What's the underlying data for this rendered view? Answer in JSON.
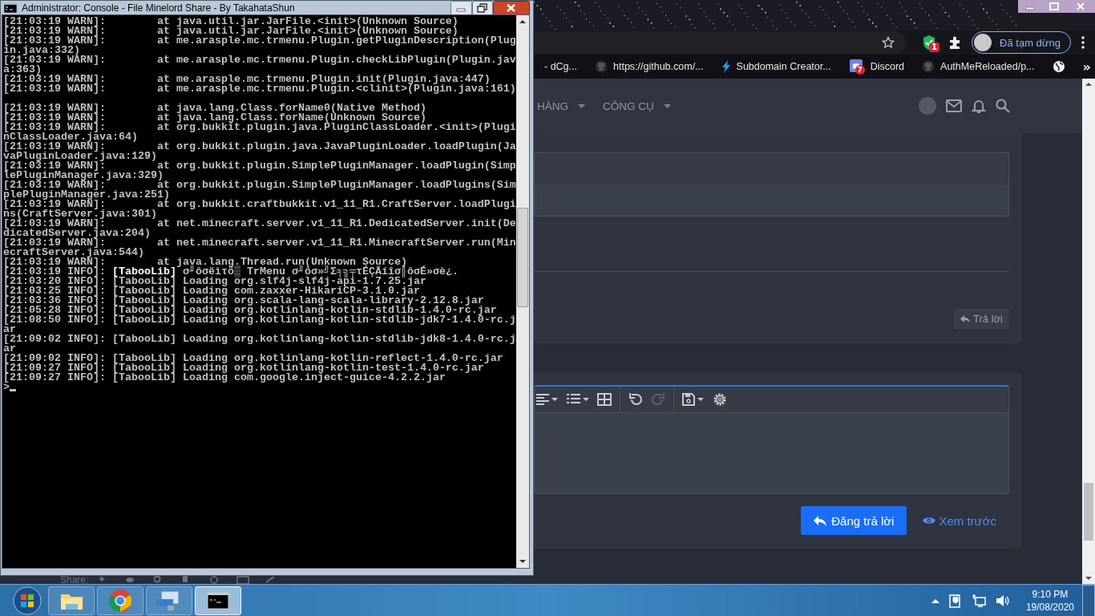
{
  "browser": {
    "extension_badge": "1",
    "profile_label": "Đã tạm dừng",
    "bookmarks": [
      {
        "kind": "plain",
        "label": "- dCg..."
      },
      {
        "kind": "github",
        "label": "https://github.com/..."
      },
      {
        "kind": "bolt",
        "label": "Subdomain Creator..."
      },
      {
        "kind": "discord",
        "label": "Discord",
        "badge": "7"
      },
      {
        "kind": "github",
        "label": "AuthMeReloaded/p..."
      }
    ],
    "bookmarks_overflow": "»"
  },
  "forum": {
    "nav": [
      {
        "label": "HÀNG"
      },
      {
        "label": "CÔNG CỤ"
      }
    ],
    "reply_button": "Trả lời",
    "editor_tools": [
      {
        "kind": "align",
        "disabled": false
      },
      {
        "kind": "list",
        "disabled": false
      },
      {
        "kind": "table",
        "disabled": false
      },
      {
        "kind": "undo",
        "disabled": false
      },
      {
        "kind": "redo",
        "disabled": true
      },
      {
        "kind": "save",
        "disabled": false
      },
      {
        "kind": "settings",
        "disabled": false
      }
    ],
    "post_button": "Đăng trả lời",
    "preview_link": "Xem trước",
    "share_label": "Share:"
  },
  "console": {
    "title": "Administrator:  Console - File Minelord Share - By TakahataShun",
    "lines": [
      "[21:03:19 WARN]:        at java.util.jar.JarFile.<init>(Unknown Source)",
      "[21:03:19 WARN]:        at java.util.jar.JarFile.<init>(Unknown Source)",
      "[21:03:19 WARN]:        at me.arasple.mc.trmenu.Plugin.getPluginDescription(Plugin.java:332)",
      "[21:03:19 WARN]:        at me.arasple.mc.trmenu.Plugin.checkLibPlugin(Plugin.java:363)",
      "[21:03:19 WARN]:        at me.arasple.mc.trmenu.Plugin.init(Plugin.java:447)",
      "[21:03:19 WARN]:        at me.arasple.mc.trmenu.Plugin.<clinit>(Plugin.java:161)",
      "[21:03:19 WARN]:        at java.lang.Class.forName0(Native Method)",
      "[21:03:19 WARN]:        at java.lang.Class.forName(Unknown Source)",
      "[21:03:19 WARN]:        at org.bukkit.plugin.java.PluginClassLoader.<init>(PluginClassLoader.java:64)",
      "[21:03:19 WARN]:        at org.bukkit.plugin.java.JavaPluginLoader.loadPlugin(JavaPluginLoader.java:129)",
      "[21:03:19 WARN]:        at org.bukkit.plugin.SimplePluginManager.loadPlugin(SimplePluginManager.java:329)",
      "[21:03:19 WARN]:        at org.bukkit.plugin.SimplePluginManager.loadPlugins(SimplePluginManager.java:251)",
      "[21:03:19 WARN]:        at org.bukkit.craftbukkit.v1_11_R1.CraftServer.loadPlugins(CraftServer.java:301)",
      "[21:03:19 WARN]:        at net.minecraft.server.v1_11_R1.DedicatedServer.init(DedicatedServer.java:204)",
      "[21:03:19 WARN]:        at net.minecraft.server.v1_11_R1.MinecraftServer.run(MinecraftServer.java:544)",
      "[21:03:19 WARN]:        at java.lang.Thread.run(Unknown Source)",
      "[21:03:19 INFO]: **[TabooLib]** σ╜ôσëìτö▒ TrMenu σ╜ôσ»╝Σ╕╗╤τÉÇÄíîσ║ôσÉ»σè¿.",
      "[21:03:20 INFO]: [TabooLib] Loading org.slf4j-slf4j-api-1.7.25.jar",
      "[21:03:25 INFO]: [TabooLib] Loading com.zaxxer-HikariCP-3.1.0.jar",
      "[21:03:36 INFO]: [TabooLib] Loading org.scala-lang-scala-library-2.12.8.jar",
      "[21:05:28 INFO]: [TabooLib] Loading org.kotlinlang-kotlin-stdlib-1.4.0-rc.jar",
      "[21:08:50 INFO]: [TabooLib] Loading org.kotlinlang-kotlin-stdlib-jdk7-1.4.0-rc.jar",
      "[21:09:02 INFO]: [TabooLib] Loading org.kotlinlang-kotlin-stdlib-jdk8-1.4.0-rc.jar",
      "[21:09:02 INFO]: [TabooLib] Loading org.kotlinlang-kotlin-reflect-1.4.0-rc.jar",
      "[21:09:27 INFO]: [TabooLib] Loading org.kotlinlang-kotlin-test-1.4.0-rc.jar",
      "[21:09:27 INFO]: [TabooLib] Loading com.google.inject-guice-4.2.2.jar"
    ],
    "prompt": ">"
  },
  "taskbar": {
    "apps": [
      {
        "kind": "explorer",
        "selected": false
      },
      {
        "kind": "chrome",
        "selected": false
      },
      {
        "kind": "remote",
        "selected": false
      },
      {
        "kind": "console",
        "selected": true
      }
    ],
    "time": "9:10 PM",
    "date": "19/08/2020"
  }
}
